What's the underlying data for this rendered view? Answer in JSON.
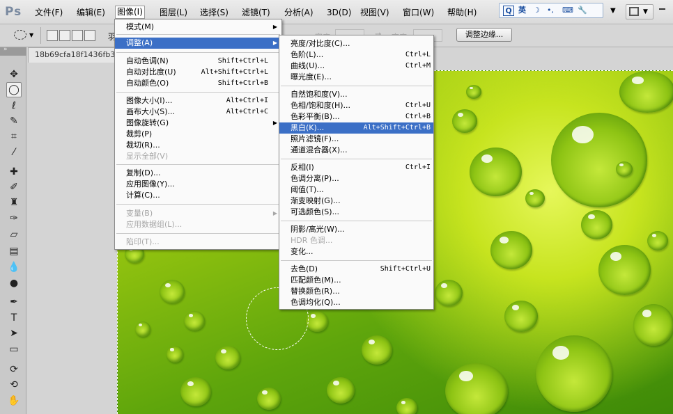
{
  "app": {
    "logo": "Ps"
  },
  "menubar": {
    "items": [
      "文件(F)",
      "编辑(E)",
      "图像(I)",
      "图层(L)",
      "选择(S)",
      "滤镜(T)",
      "分析(A)",
      "3D(D)",
      "视图(V)",
      "窗口(W)",
      "帮助(H)"
    ],
    "active_index": 2
  },
  "ime": {
    "label": "英",
    "icons": [
      "ime-logo-icon",
      "moon-icon",
      "dot-icon",
      "keyboard-icon",
      "wrench-icon"
    ]
  },
  "options": {
    "partial_label": "羽",
    "refine_edge_label": "调整边缘...",
    "faded_width_label": "宽度",
    "faded_height_label": "高度"
  },
  "document": {
    "tab_title": "18b69cfa18f1436fb3"
  },
  "image_menu": {
    "items": [
      {
        "label": "模式(M)",
        "shortcut": "",
        "submenu": true,
        "disabled": false,
        "highlighted": false
      },
      {
        "label": "调整(A)",
        "shortcut": "",
        "submenu": true,
        "disabled": false,
        "highlighted": true
      },
      {
        "label": "自动色调(N)",
        "shortcut": "Shift+Ctrl+L",
        "submenu": false,
        "disabled": false,
        "highlighted": false
      },
      {
        "label": "自动对比度(U)",
        "shortcut": "Alt+Shift+Ctrl+L",
        "submenu": false,
        "disabled": false,
        "highlighted": false
      },
      {
        "label": "自动颜色(O)",
        "shortcut": "Shift+Ctrl+B",
        "submenu": false,
        "disabled": false,
        "highlighted": false
      },
      {
        "label": "图像大小(I)...",
        "shortcut": "Alt+Ctrl+I",
        "submenu": false,
        "disabled": false,
        "highlighted": false
      },
      {
        "label": "画布大小(S)...",
        "shortcut": "Alt+Ctrl+C",
        "submenu": false,
        "disabled": false,
        "highlighted": false
      },
      {
        "label": "图像旋转(G)",
        "shortcut": "",
        "submenu": true,
        "disabled": false,
        "highlighted": false
      },
      {
        "label": "裁剪(P)",
        "shortcut": "",
        "submenu": false,
        "disabled": false,
        "highlighted": false
      },
      {
        "label": "裁切(R)...",
        "shortcut": "",
        "submenu": false,
        "disabled": false,
        "highlighted": false
      },
      {
        "label": "显示全部(V)",
        "shortcut": "",
        "submenu": false,
        "disabled": true,
        "highlighted": false
      },
      {
        "label": "复制(D)...",
        "shortcut": "",
        "submenu": false,
        "disabled": false,
        "highlighted": false
      },
      {
        "label": "应用图像(Y)...",
        "shortcut": "",
        "submenu": false,
        "disabled": false,
        "highlighted": false
      },
      {
        "label": "计算(C)...",
        "shortcut": "",
        "submenu": false,
        "disabled": false,
        "highlighted": false
      },
      {
        "label": "变量(B)",
        "shortcut": "",
        "submenu": true,
        "disabled": true,
        "highlighted": false
      },
      {
        "label": "应用数据组(L)...",
        "shortcut": "",
        "submenu": false,
        "disabled": true,
        "highlighted": false
      },
      {
        "label": "陷印(T)...",
        "shortcut": "",
        "submenu": false,
        "disabled": true,
        "highlighted": false
      }
    ]
  },
  "adjust_menu": {
    "items": [
      {
        "label": "亮度/对比度(C)...",
        "shortcut": "",
        "disabled": false,
        "highlighted": false
      },
      {
        "label": "色阶(L)...",
        "shortcut": "Ctrl+L",
        "disabled": false,
        "highlighted": false
      },
      {
        "label": "曲线(U)...",
        "shortcut": "Ctrl+M",
        "disabled": false,
        "highlighted": false
      },
      {
        "label": "曝光度(E)...",
        "shortcut": "",
        "disabled": false,
        "highlighted": false
      },
      {
        "label": "自然饱和度(V)...",
        "shortcut": "",
        "disabled": false,
        "highlighted": false
      },
      {
        "label": "色相/饱和度(H)...",
        "shortcut": "Ctrl+U",
        "disabled": false,
        "highlighted": false
      },
      {
        "label": "色彩平衡(B)...",
        "shortcut": "Ctrl+B",
        "disabled": false,
        "highlighted": false
      },
      {
        "label": "黑白(K)...",
        "shortcut": "Alt+Shift+Ctrl+B",
        "disabled": false,
        "highlighted": true
      },
      {
        "label": "照片滤镜(F)...",
        "shortcut": "",
        "disabled": false,
        "highlighted": false
      },
      {
        "label": "通道混合器(X)...",
        "shortcut": "",
        "disabled": false,
        "highlighted": false
      },
      {
        "label": "反相(I)",
        "shortcut": "Ctrl+I",
        "disabled": false,
        "highlighted": false
      },
      {
        "label": "色调分离(P)...",
        "shortcut": "",
        "disabled": false,
        "highlighted": false
      },
      {
        "label": "阈值(T)...",
        "shortcut": "",
        "disabled": false,
        "highlighted": false
      },
      {
        "label": "渐变映射(G)...",
        "shortcut": "",
        "disabled": false,
        "highlighted": false
      },
      {
        "label": "可选颜色(S)...",
        "shortcut": "",
        "disabled": false,
        "highlighted": false
      },
      {
        "label": "阴影/高光(W)...",
        "shortcut": "",
        "disabled": false,
        "highlighted": false
      },
      {
        "label": "HDR 色调...",
        "shortcut": "",
        "disabled": true,
        "highlighted": false
      },
      {
        "label": "变化...",
        "shortcut": "",
        "disabled": false,
        "highlighted": false
      },
      {
        "label": "去色(D)",
        "shortcut": "Shift+Ctrl+U",
        "disabled": false,
        "highlighted": false
      },
      {
        "label": "匹配颜色(M)...",
        "shortcut": "",
        "disabled": false,
        "highlighted": false
      },
      {
        "label": "替换颜色(R)...",
        "shortcut": "",
        "disabled": false,
        "highlighted": false
      },
      {
        "label": "色调均化(Q)...",
        "shortcut": "",
        "disabled": false,
        "highlighted": false
      }
    ]
  },
  "tools": [
    {
      "name": "move-tool-icon",
      "glyph": "✥"
    },
    {
      "name": "elliptical-marquee-tool-icon",
      "glyph": "◯",
      "selected": true
    },
    {
      "name": "lasso-tool-icon",
      "glyph": "ℓ"
    },
    {
      "name": "quick-selection-tool-icon",
      "glyph": "✎"
    },
    {
      "name": "crop-tool-icon",
      "glyph": "⌗"
    },
    {
      "name": "eyedropper-tool-icon",
      "glyph": "⁄"
    },
    {
      "name": "healing-brush-tool-icon",
      "glyph": "✚"
    },
    {
      "name": "brush-tool-icon",
      "glyph": "✐"
    },
    {
      "name": "clone-stamp-tool-icon",
      "glyph": "♜"
    },
    {
      "name": "history-brush-tool-icon",
      "glyph": "✑"
    },
    {
      "name": "eraser-tool-icon",
      "glyph": "▱"
    },
    {
      "name": "gradient-tool-icon",
      "glyph": "▤"
    },
    {
      "name": "blur-tool-icon",
      "glyph": "💧"
    },
    {
      "name": "dodge-tool-icon",
      "glyph": "●"
    },
    {
      "name": "pen-tool-icon",
      "glyph": "✒"
    },
    {
      "name": "type-tool-icon",
      "glyph": "T"
    },
    {
      "name": "path-selection-tool-icon",
      "glyph": "➤"
    },
    {
      "name": "rectangle-tool-icon",
      "glyph": "▭"
    },
    {
      "name": "3d-rotate-tool-icon",
      "glyph": "⟳"
    },
    {
      "name": "3d-orbit-tool-icon",
      "glyph": "⟲"
    },
    {
      "name": "hand-tool-icon",
      "glyph": "✋"
    }
  ],
  "colors": {
    "highlight": "#3b6fc6",
    "disabled_text": "#a6a6a6"
  }
}
